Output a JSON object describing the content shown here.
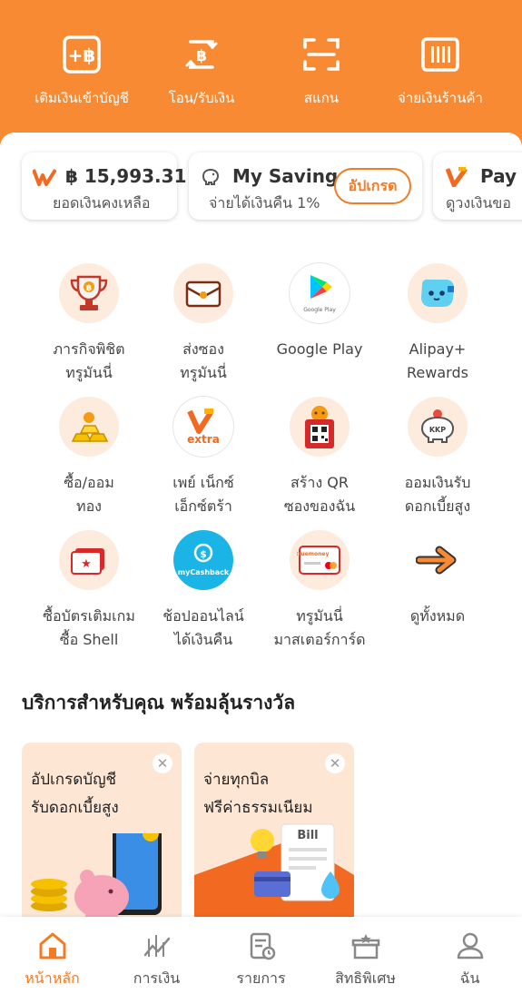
{
  "header": {
    "actions": [
      {
        "label": "เติมเงินเข้าบัญชี",
        "icon": "top-up-baht-icon"
      },
      {
        "label": "โอน/รับเงิน",
        "icon": "transfer-baht-icon"
      },
      {
        "label": "สแกน",
        "icon": "scan-icon"
      },
      {
        "label": "จ่ายเงินร้านค้า",
        "icon": "barcode-pay-icon"
      }
    ]
  },
  "chips": {
    "balance": {
      "amount": "฿ 15,993.31",
      "label": "ยอดเงินคงเหลือ"
    },
    "saving": {
      "title": "My Saving",
      "subtitle": "จ่ายได้เงินคืน 1%",
      "button": "อัปเกรด"
    },
    "paynext": {
      "title": "Pay N",
      "subtitle": "ดูวงเงินขอ"
    }
  },
  "services": [
    {
      "label": "ภารกิจพิชิต\nทรูมันนี่",
      "icon": "trophy-icon"
    },
    {
      "label": "ส่งซอง\nทรูมันนี่",
      "icon": "envelope-icon"
    },
    {
      "label": "Google Play",
      "icon": "google-play-icon"
    },
    {
      "label": "Alipay+\nRewards",
      "icon": "alipay-mascot-icon"
    },
    {
      "label": "ซื้อ/ออม\nทอง",
      "icon": "gold-bars-icon"
    },
    {
      "label": "เพย์ เน็กซ์\nเอ็กซ์ตร้า",
      "icon": "paynext-extra-icon"
    },
    {
      "label": "สร้าง QR\nซองของฉัน",
      "icon": "qr-envelope-icon"
    },
    {
      "label": "ออมเงินรับ\nดอกเบี้ยสูง",
      "icon": "kkp-piggy-icon"
    },
    {
      "label": "ซื้อบัตรเติมเกม\nซื้อ Shell",
      "icon": "game-ticket-icon"
    },
    {
      "label": "ช้อปออนไลน์\nได้เงินคืน",
      "icon": "mycashback-icon"
    },
    {
      "label": "ทรูมันนี่\nมาสเตอร์การ์ด",
      "icon": "truemoney-card-icon"
    },
    {
      "label": "ดูทั้งหมด",
      "icon": "arrow-right-icon"
    }
  ],
  "logos": {
    "google_play": "Google Play",
    "extra": "extra",
    "kkp": "KKP",
    "mycashback": "myCashback",
    "truemoney": "truemoney",
    "bill": "Bill"
  },
  "section_title": "บริการสำหรับคุณ พร้อมลุ้นรางวัล",
  "promos": [
    {
      "text": "อัปเกรดบัญชี\nรับดอกเบี้ยสูง"
    },
    {
      "text": "จ่ายทุกบิล\nฟรีค่าธรรมเนียม"
    }
  ],
  "bottom_nav": [
    {
      "label": "หน้าหลัก",
      "icon": "home-icon",
      "active": true
    },
    {
      "label": "การเงิน",
      "icon": "finance-chart-icon",
      "active": false
    },
    {
      "label": "รายการ",
      "icon": "transactions-icon",
      "active": false
    },
    {
      "label": "สิทธิพิเศษ",
      "icon": "privilege-gift-icon",
      "active": false
    },
    {
      "label": "ฉัน",
      "icon": "profile-icon",
      "active": false
    }
  ],
  "colors": {
    "brand_orange": "#f78a33",
    "accent": "#f27b24",
    "icon_bg": "#fdebdd",
    "promo_bg": "#fde6d4"
  }
}
